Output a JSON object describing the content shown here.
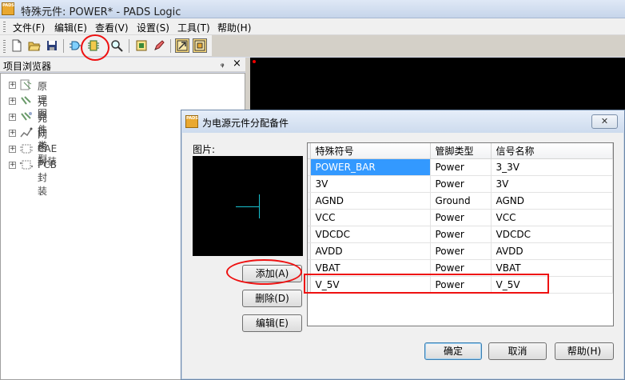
{
  "window": {
    "title": "特殊元件: POWER* - PADS Logic",
    "logo_text": "PADS"
  },
  "menu": [
    {
      "label": "文件(F)"
    },
    {
      "label": "编辑(E)"
    },
    {
      "label": "查看(V)"
    },
    {
      "label": "设置(S)"
    },
    {
      "label": "工具(T)"
    },
    {
      "label": "帮助(H)"
    }
  ],
  "toolbar": {
    "icons": [
      "new-file-icon",
      "open-folder-icon",
      "save-icon",
      "gate-icon",
      "pin-icon",
      "zoom-icon",
      "properties-icon",
      "pencil-icon",
      "view-pcb-icon",
      "view-logic-icon"
    ]
  },
  "browser": {
    "title": "项目浏览器",
    "pin_glyph": "ᵩ",
    "close_glyph": "×",
    "items": [
      {
        "label": "原理图",
        "icon": "schematic-icon",
        "expander": "+"
      },
      {
        "label": "元器件",
        "icon": "component-icon",
        "expander": "+"
      },
      {
        "label": "元件类型",
        "icon": "part-type-icon",
        "expander": "+"
      },
      {
        "label": "网络",
        "icon": "net-icon",
        "expander": "+"
      },
      {
        "label": "CAE 封装",
        "icon": "cae-decal-icon",
        "expander": "+"
      },
      {
        "label": "PCB 封装",
        "icon": "pcb-decal-icon",
        "expander": "+"
      }
    ]
  },
  "dialog": {
    "title": "为电源元件分配备件",
    "logo_text": "PADS",
    "close_glyph": "✕",
    "picture_label": "图片:",
    "add_label": "添加(A)",
    "delete_label": "删除(D)",
    "edit_label": "编辑(E)",
    "ok_label": "确定",
    "cancel_label": "取消",
    "help_label": "帮助(H)",
    "grid": {
      "headers": [
        "特殊符号",
        "管脚类型",
        "信号名称"
      ],
      "rows": [
        [
          "POWER_BAR",
          "Power",
          "3_3V"
        ],
        [
          "3V",
          "Power",
          "3V"
        ],
        [
          "AGND",
          "Ground",
          "AGND"
        ],
        [
          "VCC",
          "Power",
          "VCC"
        ],
        [
          "VDCDC",
          "Power",
          "VDCDC"
        ],
        [
          "AVDD",
          "Power",
          "AVDD"
        ],
        [
          "VBAT",
          "Power",
          "VBAT"
        ],
        [
          "V_5V",
          "Power",
          "V_5V"
        ]
      ],
      "selected_row": 0,
      "highlighted_row": 7
    }
  },
  "colors": {
    "selection": "#3399ff",
    "annotation": "#ee1111",
    "symbol_line": "#19c1cf"
  }
}
